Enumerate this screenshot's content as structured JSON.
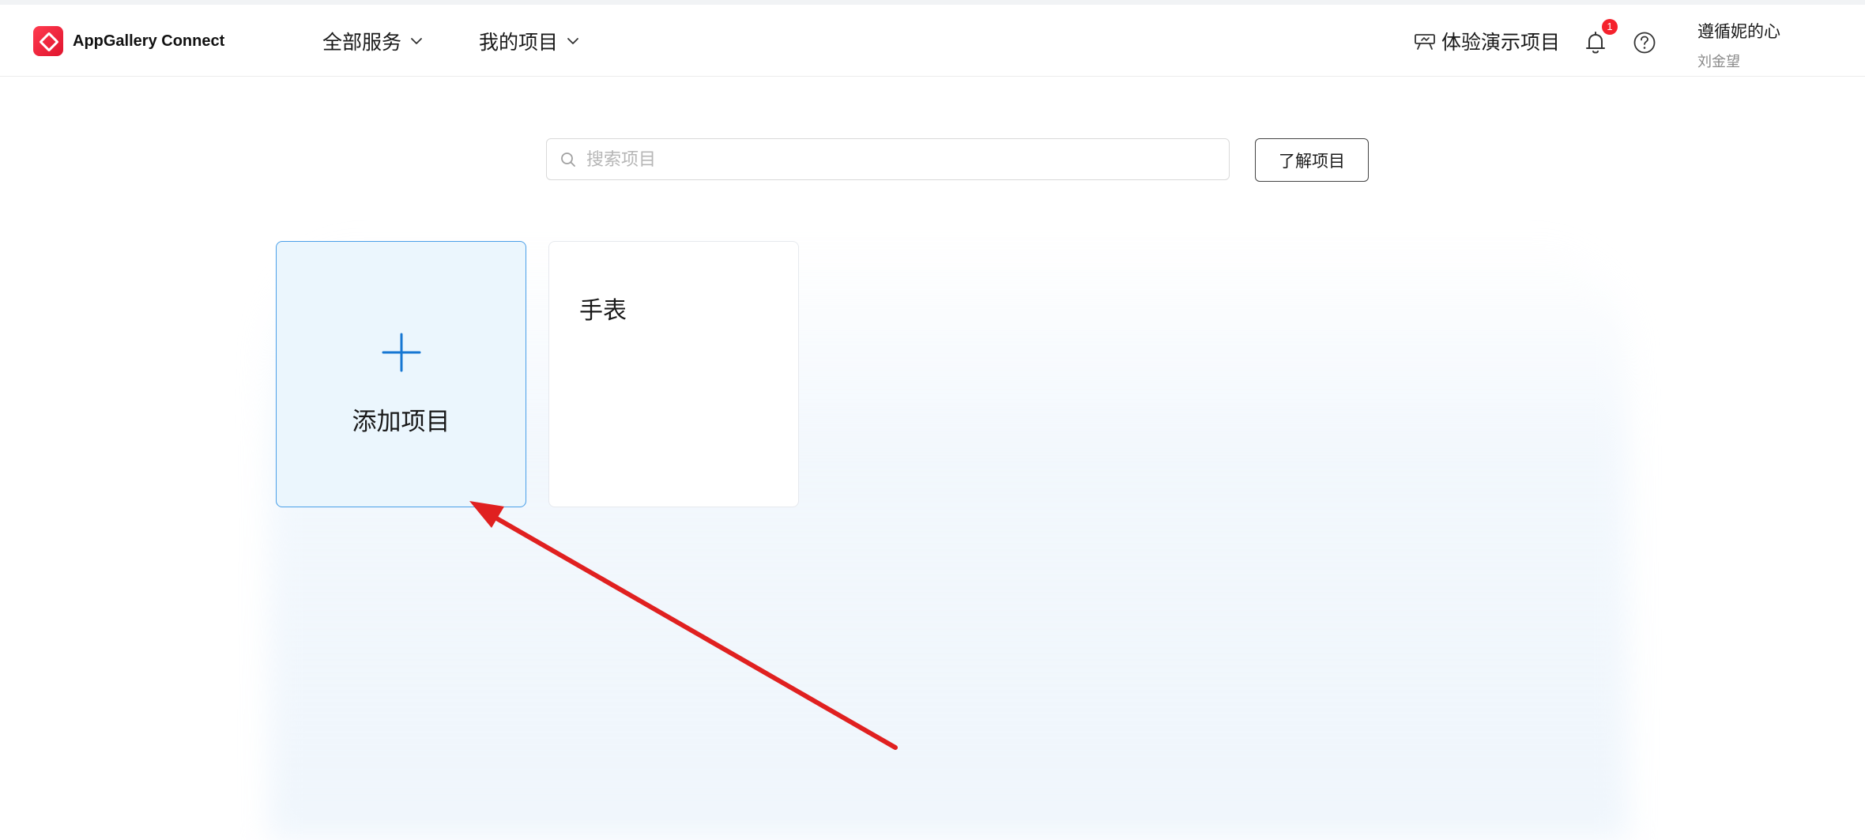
{
  "header": {
    "brand": "AppGallery Connect",
    "nav": [
      {
        "label": "全部服务"
      },
      {
        "label": "我的项目"
      }
    ],
    "demo_label": "体验演示项目",
    "notification_count": "1",
    "user": {
      "name": "遵循妮的心",
      "sub": "刘金望"
    }
  },
  "search": {
    "placeholder": "搜索项目",
    "value": ""
  },
  "learn_button": "了解项目",
  "cards": {
    "add_label": "添加项目",
    "projects": [
      {
        "name": "手表"
      }
    ]
  },
  "colors": {
    "accent": "#1677d2",
    "brand_red": "#e0142e",
    "annotation": "#e02020"
  },
  "icons": {
    "brand": "appgallery-logo-icon",
    "chevron": "chevron-down-icon",
    "demo": "demo-projector-icon",
    "bell": "bell-icon",
    "help": "help-circle-icon",
    "search": "search-icon",
    "plus": "plus-icon"
  }
}
